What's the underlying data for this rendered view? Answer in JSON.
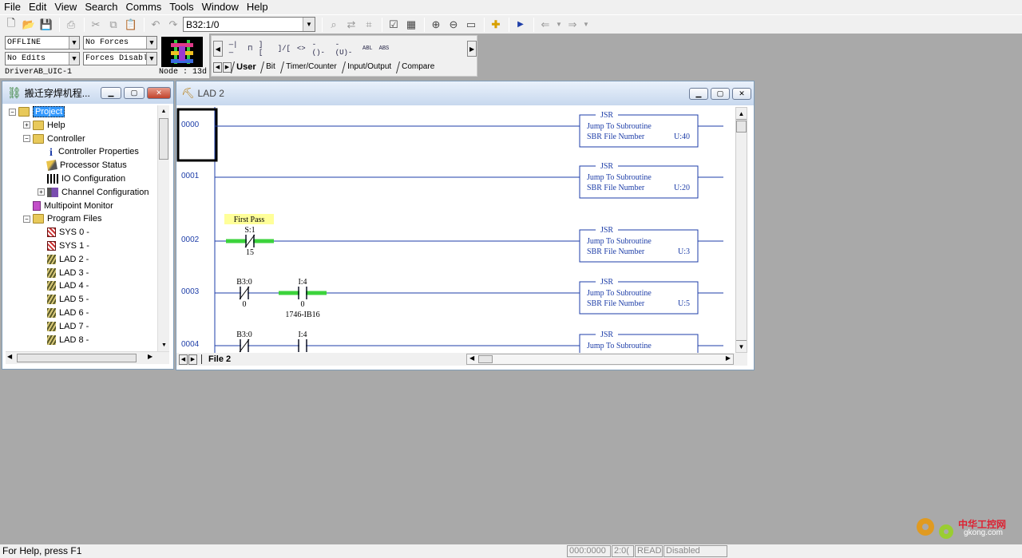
{
  "menu": [
    "File",
    "Edit",
    "View",
    "Search",
    "Comms",
    "Tools",
    "Window",
    "Help"
  ],
  "toolbar": {
    "address_value": "B32:1/0",
    "icons": [
      "new-icon",
      "open-icon",
      "save-icon",
      "print-icon",
      "cut-icon",
      "copy-icon",
      "paste-icon",
      "undo-icon",
      "redo-icon",
      "search-icon",
      "replace-icon",
      "crossref-icon",
      "verify-file-icon",
      "verify-project-icon",
      "zoom-in-icon",
      "zoom-out-icon",
      "window-icon",
      "add-icon",
      "play-icon",
      "back-icon",
      "forward-icon"
    ]
  },
  "status_panel": {
    "mode": "OFFLINE",
    "forces": "No Forces",
    "edits": "No Edits",
    "forces_state": "Forces Disable",
    "driver": "DriverAB_UIC-1",
    "node": "Node : 13d"
  },
  "palette": {
    "instructions": [
      "—|—",
      "⊓",
      "] [",
      "]/[",
      "<>",
      "-()-",
      "-(U)-",
      "ABL",
      "ABS"
    ],
    "tabs": [
      "User",
      "Bit",
      "Timer/Counter",
      "Input/Output",
      "Compare"
    ],
    "active_tab": "User"
  },
  "project_window": {
    "title": "搬迁穿焊机程...",
    "tree": [
      {
        "label": "Project",
        "level": 0,
        "exp": "−",
        "icon": "folder",
        "selected": true
      },
      {
        "label": "Help",
        "level": 1,
        "exp": "+",
        "icon": "folder"
      },
      {
        "label": "Controller",
        "level": 1,
        "exp": "−",
        "icon": "folder"
      },
      {
        "label": "Controller Properties",
        "level": 2,
        "icon": "info"
      },
      {
        "label": "Processor Status",
        "level": 2,
        "icon": "pencil"
      },
      {
        "label": "IO Configuration",
        "level": 2,
        "icon": "io"
      },
      {
        "label": "Channel Configuration",
        "level": 2,
        "exp": "+",
        "icon": "chan"
      },
      {
        "label": "Multipoint Monitor",
        "level": 1,
        "icon": "multi"
      },
      {
        "label": "Program Files",
        "level": 1,
        "exp": "−",
        "icon": "folder"
      },
      {
        "label": "SYS 0 -",
        "level": 2,
        "icon": "sys"
      },
      {
        "label": "SYS 1 -",
        "level": 2,
        "icon": "sys"
      },
      {
        "label": "LAD 2 -",
        "level": 2,
        "icon": "lad"
      },
      {
        "label": "LAD 3 -",
        "level": 2,
        "icon": "lad"
      },
      {
        "label": "LAD 4 -",
        "level": 2,
        "icon": "lad"
      },
      {
        "label": "LAD 5 -",
        "level": 2,
        "icon": "lad"
      },
      {
        "label": "LAD 6 -",
        "level": 2,
        "icon": "lad"
      },
      {
        "label": "LAD 7 -",
        "level": 2,
        "icon": "lad"
      },
      {
        "label": "LAD 8 -",
        "level": 2,
        "icon": "lad"
      }
    ]
  },
  "lad_window": {
    "title": "LAD 2",
    "file_tab": "File 2",
    "rungs": [
      {
        "num": "0000",
        "contacts": [],
        "jsr": {
          "title": "JSR",
          "line1": "Jump To Subroutine",
          "line2": "SBR File Number",
          "value": "U:40"
        }
      },
      {
        "num": "0001",
        "contacts": [],
        "jsr": {
          "title": "JSR",
          "line1": "Jump To Subroutine",
          "line2": "SBR File Number",
          "value": "U:20"
        }
      },
      {
        "num": "0002",
        "comment": "First Pass",
        "contacts": [
          {
            "addr": "S:1",
            "bit": "15",
            "type": "XIO",
            "active": true
          }
        ],
        "jsr": {
          "title": "JSR",
          "line1": "Jump To Subroutine",
          "line2": "SBR File Number",
          "value": "U:3"
        }
      },
      {
        "num": "0003",
        "contacts": [
          {
            "addr": "B3:0",
            "bit": "0",
            "type": "XIO",
            "active": false
          },
          {
            "addr": "I:4",
            "bit": "0",
            "type": "XIC",
            "active": true,
            "desc": "1746-IB16"
          }
        ],
        "jsr": {
          "title": "JSR",
          "line1": "Jump To Subroutine",
          "line2": "SBR File Number",
          "value": "U:5"
        }
      },
      {
        "num": "0004",
        "contacts": [
          {
            "addr": "B3:0",
            "bit": "",
            "type": "XIO",
            "active": false
          },
          {
            "addr": "I:4",
            "bit": "",
            "type": "XIC",
            "active": false
          }
        ],
        "jsr": {
          "title": "JSR",
          "line1": "Jump To Subroutine",
          "line2": "",
          "value": ""
        }
      }
    ]
  },
  "statusbar": {
    "help": "For Help, press F1",
    "position": "000:0000",
    "app": "2:0(",
    "mode": "READ",
    "state": "Disabled"
  },
  "watermark": {
    "brand": "中华工控网",
    "url": "gkong.com"
  },
  "colors": {
    "wire": "#1e3ea8",
    "energized": "#3cd33c",
    "comment_bg": "#ffff99",
    "selection": "#3399ff"
  }
}
